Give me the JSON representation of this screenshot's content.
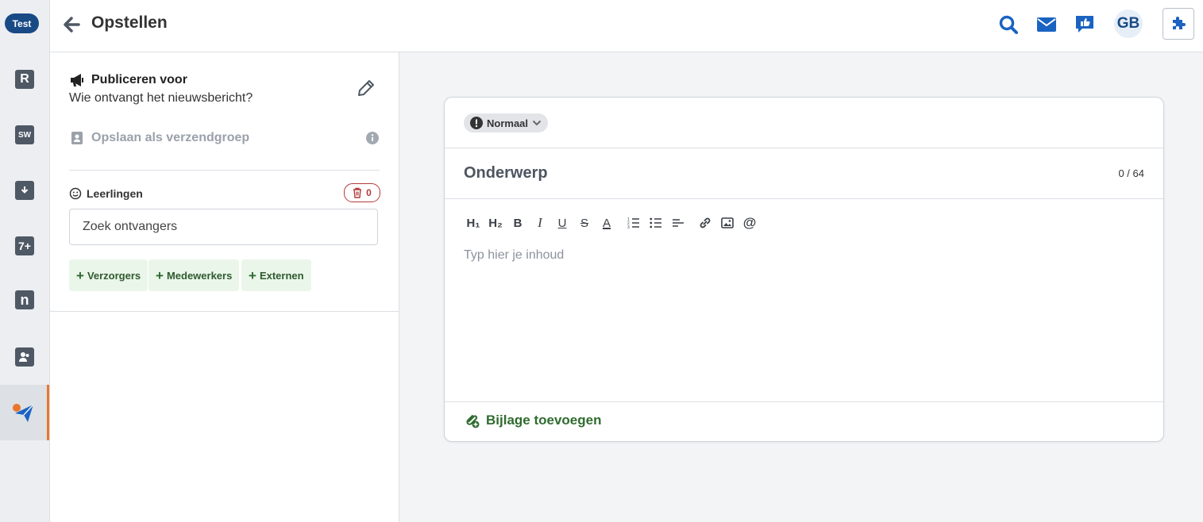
{
  "rail": {
    "env_label": "Test",
    "items": [
      {
        "icon": "rooster-icon",
        "glyph": "R"
      },
      {
        "icon": "studiewijzer-icon",
        "glyph": "SW"
      },
      {
        "icon": "agenda-download-icon",
        "glyph": ""
      },
      {
        "icon": "cijfers-icon",
        "glyph": "7+"
      },
      {
        "icon": "nieuws-icon",
        "glyph": "n"
      },
      {
        "icon": "leerlingen-icon",
        "glyph": ""
      },
      {
        "icon": "berichten-send-icon",
        "glyph": ""
      }
    ]
  },
  "header": {
    "title": "Opstellen",
    "avatar_initials": "GB"
  },
  "left": {
    "publish_title": "Publiceren voor",
    "publish_subtitle": "Wie ontvangt het nieuwsbericht?",
    "save_group": "Opslaan als verzendgroep",
    "recipients_label": "Leerlingen",
    "recipients_count": "0",
    "search_placeholder": "Zoek ontvangers",
    "chips": [
      "Verzorgers",
      "Medewerkers",
      "Externen"
    ]
  },
  "editor": {
    "priority": "Normaal",
    "subject_placeholder": "Onderwerp",
    "counter": "0 / 64",
    "content_placeholder": "Typ hier je inhoud",
    "attach_label": "Bijlage toevoegen",
    "toolbar": {
      "h1": "H₁",
      "h2": "H₂",
      "bold": "B",
      "italic": "I",
      "underline": "U",
      "strike": "S",
      "color": "A"
    }
  },
  "colors": {
    "brand": "#184a86",
    "accent": "#e8762c",
    "icon_blue": "#1a63c2",
    "success": "#2f6b2f",
    "danger": "#b43a3a"
  }
}
